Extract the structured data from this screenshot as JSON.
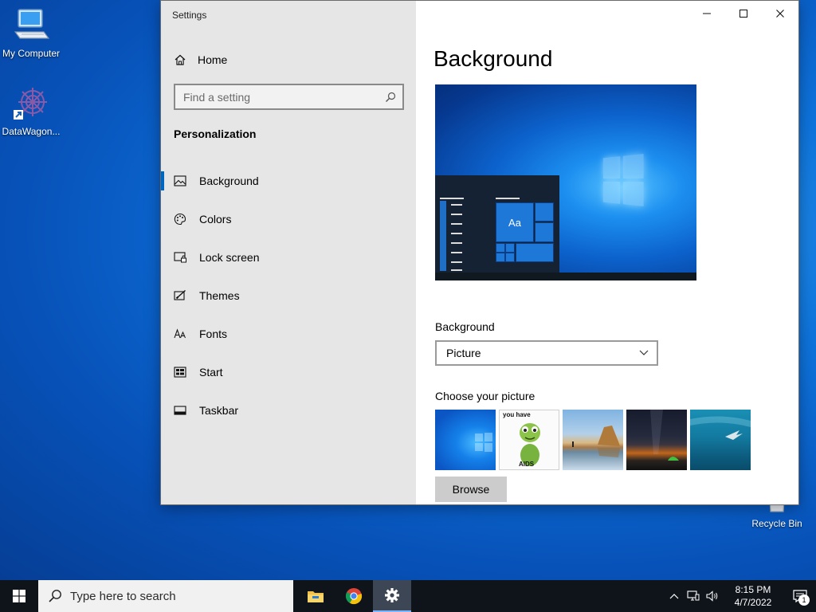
{
  "desktop": {
    "icons": [
      {
        "label": "My Computer",
        "icon": "computer-icon"
      },
      {
        "label": "DataWagon...",
        "icon": "datawagon-icon"
      },
      {
        "label": "Recycle Bin",
        "icon": "recycle-bin-icon"
      }
    ]
  },
  "window": {
    "title": "Settings",
    "controls": {
      "minimize": "minimize-icon",
      "maximize": "maximize-icon",
      "close": "close-icon"
    }
  },
  "nav": {
    "home_label": "Home",
    "search_placeholder": "Find a setting",
    "section_heading": "Personalization",
    "active_item": "Background",
    "items": [
      {
        "label": "Background",
        "icon": "picture-icon"
      },
      {
        "label": "Colors",
        "icon": "palette-icon"
      },
      {
        "label": "Lock screen",
        "icon": "lock-screen-icon"
      },
      {
        "label": "Themes",
        "icon": "themes-icon"
      },
      {
        "label": "Fonts",
        "icon": "fonts-icon"
      },
      {
        "label": "Start",
        "icon": "start-icon"
      },
      {
        "label": "Taskbar",
        "icon": "taskbar-icon"
      }
    ]
  },
  "main": {
    "title": "Background",
    "preview": {
      "tile_text": "Aa"
    },
    "background_label": "Background",
    "background_value": "Picture",
    "choose_label": "Choose your picture",
    "thumbnail_caption_top": "you have",
    "thumbnail_caption_bottom": "AIDS",
    "browse_label": "Browse"
  },
  "taskbar": {
    "search_placeholder": "Type here to search",
    "apps": [
      "file-explorer-icon",
      "chrome-icon",
      "settings-gear-icon"
    ],
    "clock": {
      "time": "8:15 PM",
      "date": "4/7/2022"
    },
    "notification_count": "1",
    "colors": {
      "accent": "#0067c0",
      "taskbar": "#0f141b"
    }
  }
}
